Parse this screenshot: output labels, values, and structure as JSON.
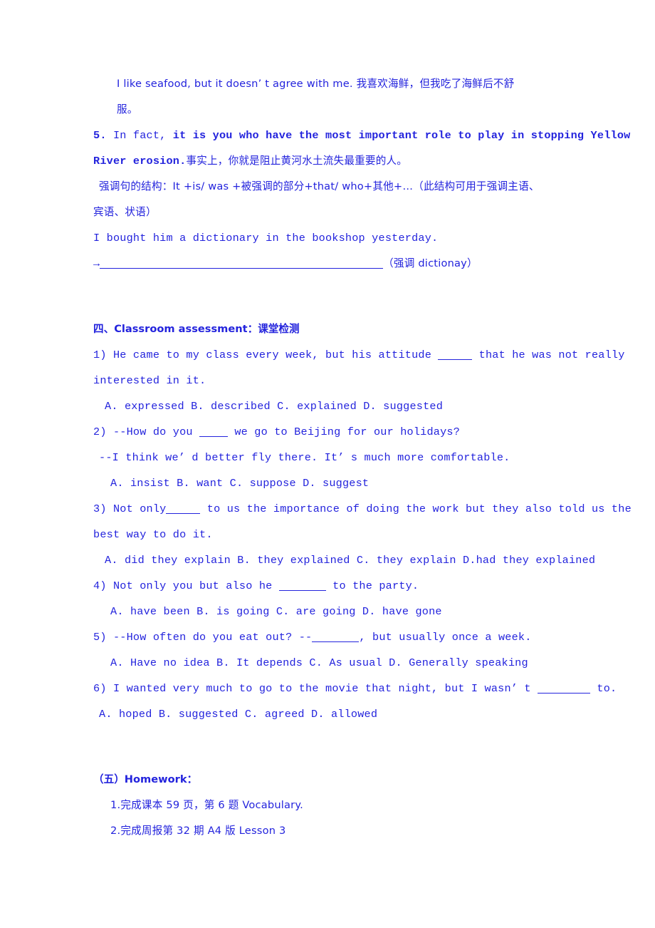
{
  "document": {
    "text_color": "#2323dd",
    "background_color": "#ffffff",
    "example_block": {
      "sentence_line1": "I like seafood, but it doesn’ t agree with me. 我喜欢海鲜，但我吃了海鲜后不舒",
      "sentence_line2": "服。"
    },
    "item5": {
      "number": "5.",
      "lead": " In fact, ",
      "bold_en_part1": "it is you who have the most important role to play in stopping Yellow",
      "bold_en_part2": "River erosion.",
      "chinese": "事实上，你就是阻止黄河水土流失最重要的人。",
      "structure_note_line1": "强调句的结构：It +is/ was +被强调的部分+that/ who+其他+…（此结构可用于强调主语、",
      "structure_note_line2": "宾语、状语）",
      "practice_sentence": "I bought him a dictionary in the bookshop yesterday.",
      "practice_arrow": "→",
      "practice_hint": "（强调 dictionay）"
    },
    "assessment": {
      "heading": "四、Classroom assessment：课堂检测",
      "questions": [
        {
          "number": "1)",
          "stem_before": " He came to my class every week, but his attitude ",
          "stem_after": " that he was not really",
          "stem_line2": "interested in it.",
          "options": "A. expressed  B. described  C. explained  D. suggested"
        },
        {
          "number": "2)",
          "stem_before": " --How do you ",
          "stem_after": " we go to Beijing for our holidays?",
          "stem_line2": "--I think we’ d better fly there. It’ s much more comfortable.",
          "options": "A. insist  B. want  C. suppose  D. suggest"
        },
        {
          "number": "3)",
          "stem_before": " Not only",
          "stem_after": " to us the importance of doing the work but they also told us the",
          "stem_line2": "best way to do it.",
          "options": "A. did they explain  B. they explained  C. they explain  D.had they explained"
        },
        {
          "number": "4)",
          "stem_before": " Not only you but also he ",
          "stem_after": " to the party.",
          "stem_line2": "",
          "options": "A. have been   B. is going  C. are going  D. have gone"
        },
        {
          "number": "5)",
          "stem_before": " --How often do you eat out?  --",
          "stem_after": ", but usually once a week.",
          "stem_line2": "",
          "options": "A. Have no idea  B. It depends  C. As usual  D. Generally speaking"
        },
        {
          "number": "6)",
          "stem_before": " I wanted very much to go to the movie that night, but I wasn’ t ",
          "stem_after": " to.",
          "stem_line2": "",
          "options": "A. hoped  B. suggested  C. agreed  D. allowed"
        }
      ]
    },
    "homework": {
      "heading": "（五）Homework：",
      "items": [
        "1.完成课本 59 页，第 6 题 Vocabulary.",
        "2.完成周报第 32 期 A4 版 Lesson 3"
      ]
    }
  }
}
